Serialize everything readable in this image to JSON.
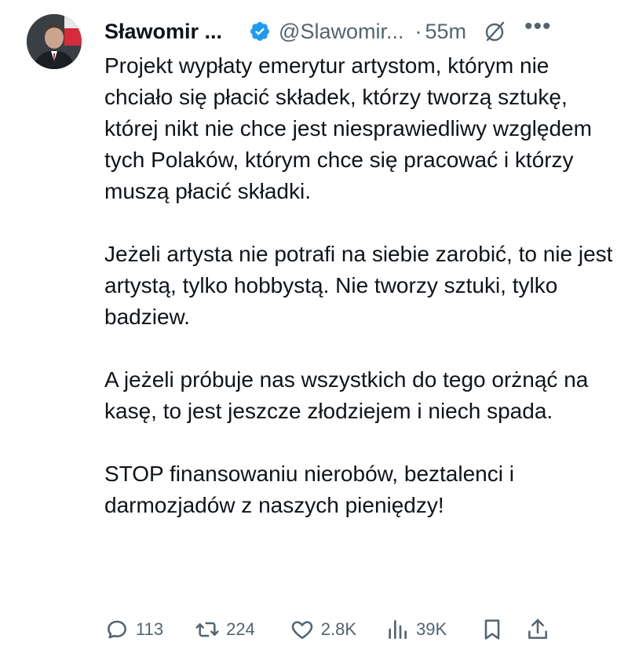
{
  "tweet": {
    "author_name": "Sławomir ...",
    "handle": "@Slawomir...",
    "separator": "·",
    "time": "55m",
    "more": "•••",
    "paragraphs": [
      "Projekt wypłaty emerytur artystom, którym nie chciało się płacić składek, którzy tworzą sztukę, której nikt nie chce jest niesprawiedliwy względem tych Polaków, którym chce się pracować i którzy muszą płacić składki.",
      "Jeżeli artysta nie potrafi na siebie zarobić, to nie jest artystą, tylko hobbystą. Nie tworzy sztuki, tylko badziew.",
      "A jeżeli próbuje nas wszystkich do tego orżnąć na kasę, to jest jeszcze złodziejem i niech spada.",
      "STOP finansowaniu nierobów, beztalenci i darmozjadów z naszych pieniędzy!"
    ],
    "stats": {
      "replies": "113",
      "retweets": "224",
      "likes": "2.8K",
      "views": "39K"
    }
  },
  "icons": {
    "verified": "verified-badge-icon",
    "grok": "grok-icon",
    "reply": "reply-icon",
    "retweet": "retweet-icon",
    "like": "heart-icon",
    "views": "views-icon",
    "bookmark": "bookmark-icon",
    "share": "share-icon"
  },
  "colors": {
    "text": "#0f1419",
    "secondary": "#536471",
    "verified": "#1d9bf0"
  }
}
